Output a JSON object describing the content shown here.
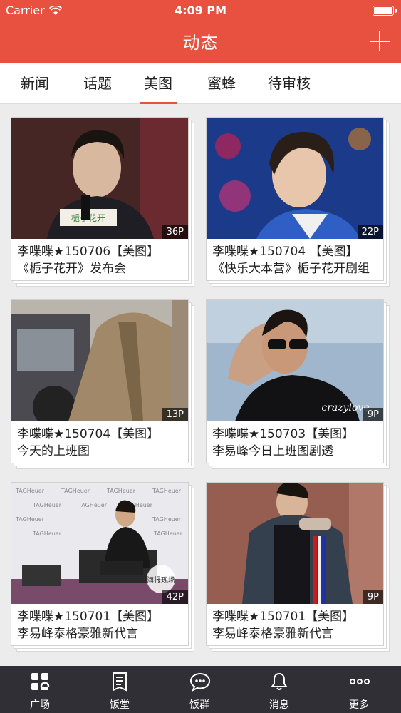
{
  "status": {
    "carrier": "Carrier",
    "time": "4:09 PM"
  },
  "header": {
    "title": "动态"
  },
  "tabs": [
    {
      "label": "新闻",
      "active": false
    },
    {
      "label": "话题",
      "active": false
    },
    {
      "label": "美图",
      "active": true
    },
    {
      "label": "蜜蜂",
      "active": false
    },
    {
      "label": "待审核",
      "active": false
    }
  ],
  "cards": [
    {
      "count": "36P",
      "line1": "李喋喋★150706【美图】",
      "line2": "《栀子花开》发布会"
    },
    {
      "count": "22P",
      "line1": "李喋喋★150704 【美图】",
      "line2": "《快乐大本营》栀子花开剧组"
    },
    {
      "count": "13P",
      "line1": "李喋喋★150704【美图】",
      "line2": "今天的上班图"
    },
    {
      "count": "9P",
      "line1": "李喋喋★150703【美图】",
      "line2": "李易峰今日上班图剧透"
    },
    {
      "count": "42P",
      "line1": "李喋喋★150701【美图】",
      "line2": "李易峰泰格豪雅新代言"
    },
    {
      "count": "9P",
      "line1": "李喋喋★150701【美图】",
      "line2": "李易峰泰格豪雅新代言"
    }
  ],
  "nav": [
    {
      "label": "广场",
      "icon": "grid-icon"
    },
    {
      "label": "饭堂",
      "icon": "book-icon"
    },
    {
      "label": "饭群",
      "icon": "chat-icon"
    },
    {
      "label": "消息",
      "icon": "bell-icon"
    },
    {
      "label": "更多",
      "icon": "more-icon"
    }
  ],
  "colors": {
    "accent": "#e8503f",
    "nav_bg": "#2f2f35"
  }
}
